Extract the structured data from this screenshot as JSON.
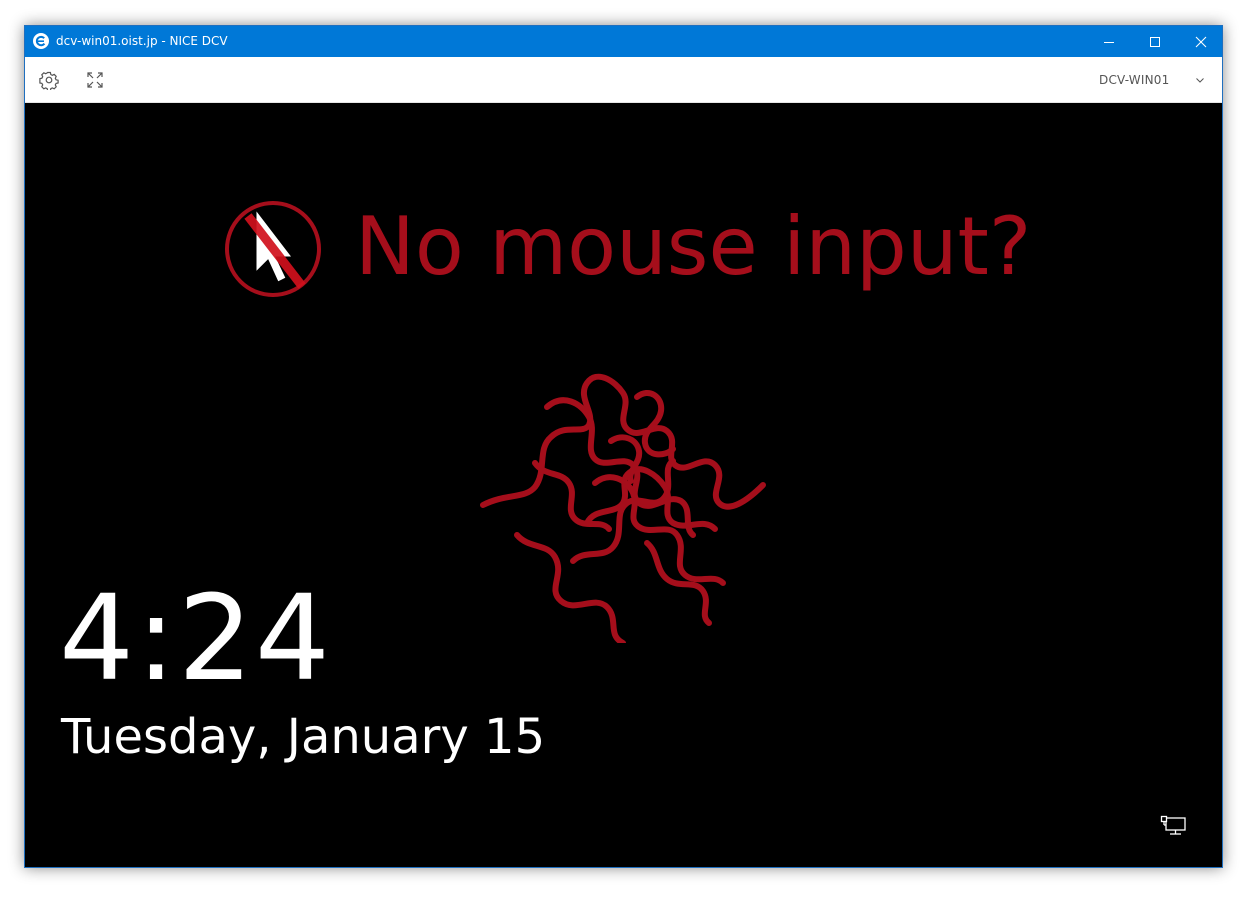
{
  "window": {
    "title": "dcv-win01.oist.jp - NICE DCV",
    "app_icon": "dcv-logo-icon",
    "controls": [
      "minimize-icon",
      "maximize-icon",
      "close-icon"
    ]
  },
  "toolbar": {
    "settings_icon": "gear-icon",
    "fullscreen_icon": "expand-icon",
    "host_select": {
      "value": "DCV-WIN01",
      "icon": "chevron-down-icon"
    }
  },
  "lock_screen": {
    "overlay_message": "No mouse input?",
    "overlay_icon": "no-mouse-icon",
    "logo": "oist-logo",
    "time": "4:24",
    "date": "Tuesday, January 15",
    "network_icon": "network-icon"
  },
  "colors": {
    "titlebar": "#0078d7",
    "accent_red": "#a50e1b",
    "background": "#000000"
  }
}
